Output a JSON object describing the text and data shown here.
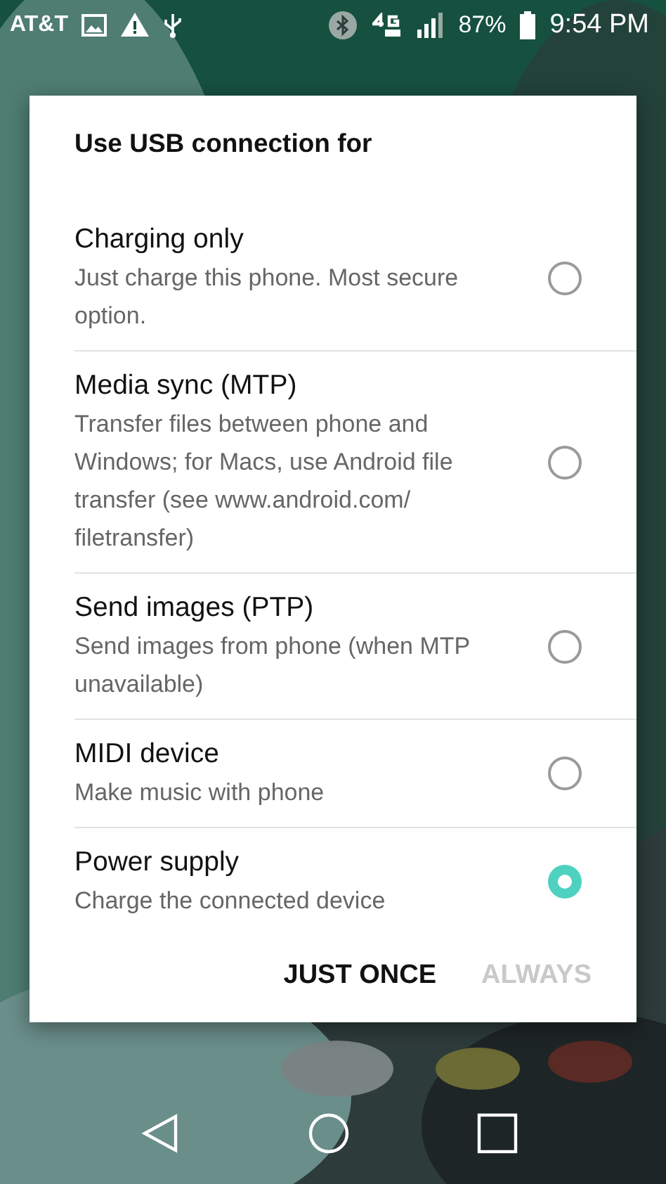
{
  "status_bar": {
    "carrier": "AT&T",
    "battery_percent": "87%",
    "time": "9:54 PM"
  },
  "dialog": {
    "title": "Use USB connection for",
    "options": [
      {
        "label": "Charging only",
        "description": "Just charge this phone. Most secure option.",
        "selected": false
      },
      {
        "label": "Media sync (MTP)",
        "description": "Transfer files between phone and Windows; for Macs, use Android file transfer (see www.android.com/ filetransfer)",
        "selected": false
      },
      {
        "label": "Send images (PTP)",
        "description": "Send images from phone (when MTP unavailable)",
        "selected": false
      },
      {
        "label": "MIDI device",
        "description": "Make music with phone",
        "selected": false
      },
      {
        "label": "Power supply",
        "description": "Charge the connected device",
        "selected": true
      }
    ],
    "buttons": [
      {
        "label": "JUST ONCE",
        "disabled": false
      },
      {
        "label": "ALWAYS",
        "disabled": true
      }
    ]
  }
}
